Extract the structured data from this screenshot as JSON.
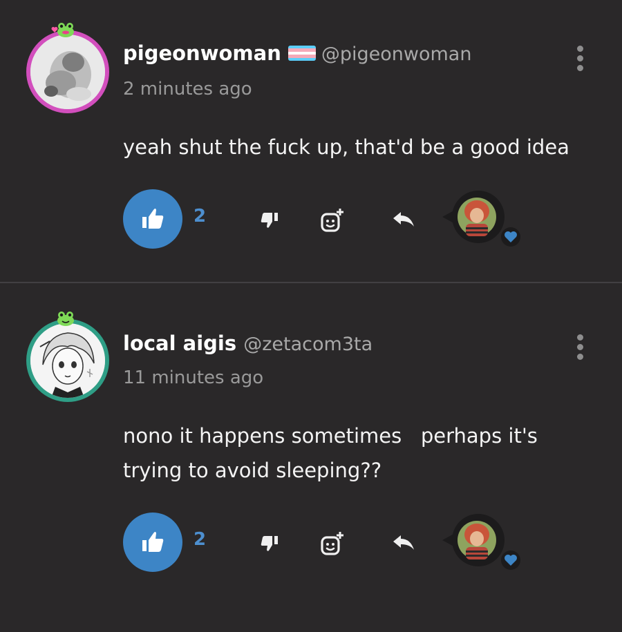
{
  "comments": [
    {
      "display_name": "pigeonwoman",
      "handle": "@pigeonwoman",
      "time": "2 minutes ago",
      "text": "yeah shut the fuck up, that'd be a good idea",
      "like_count": "2",
      "has_flag": true
    },
    {
      "display_name": "local aigis",
      "handle": "@zetacom3ta",
      "time": "11 minutes ago",
      "text": "nono it happens sometimes   perhaps it's\ntrying to avoid sleeping??",
      "like_count": "2",
      "has_flag": false
    }
  ],
  "icons": {
    "like": "thumbs-up-icon",
    "dislike": "thumbs-down-icon",
    "add_reaction": "add-emoji-icon",
    "reply": "reply-icon",
    "more": "more-vertical-icon",
    "reaction": "heart-icon"
  },
  "colors": {
    "background": "#2a2829",
    "accent": "#3d85c6",
    "avatar_ring_1": "#d24fbd",
    "avatar_ring_2": "#2f9e86",
    "muted": "#9a9a9a"
  }
}
